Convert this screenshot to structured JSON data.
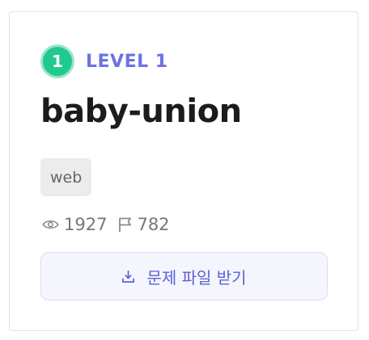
{
  "challenge": {
    "level_number": "1",
    "level_label": "LEVEL 1",
    "title": "baby-union",
    "tag": "web",
    "views": "1927",
    "solves": "782",
    "download_label": "문제 파일 받기"
  },
  "colors": {
    "accent": "#6c72e0",
    "level_badge": "#22c98f",
    "title": "#1c1c1e",
    "muted": "#777777"
  },
  "icons": {
    "views": "eye-icon",
    "solves": "flag-icon",
    "download": "download-icon"
  }
}
